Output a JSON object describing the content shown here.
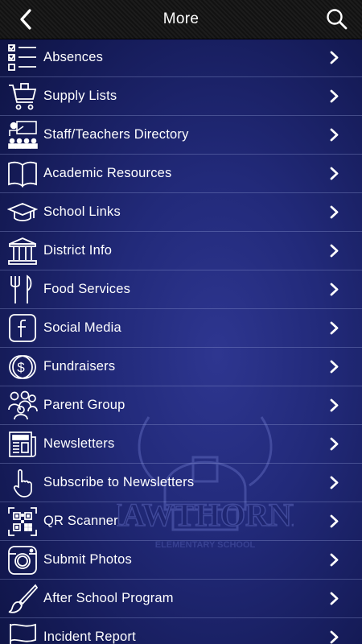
{
  "header": {
    "title": "More",
    "back_icon": "chevron-left-icon",
    "search_icon": "search-icon",
    "background": "#151515"
  },
  "colors": {
    "background_center": "#2e3690",
    "background_edge": "#0d1240",
    "row_divider": "#8a92c8",
    "text": "#ffffff"
  },
  "watermark": {
    "name": "HAWTHORNE",
    "subtitle": "ELEMENTARY SCHOOL"
  },
  "menu": {
    "items": [
      {
        "label": "Absences",
        "icon": "checklist-icon"
      },
      {
        "label": "Supply Lists",
        "icon": "shopping-cart-icon"
      },
      {
        "label": "Staff/Teachers Directory",
        "icon": "classroom-teacher-icon"
      },
      {
        "label": "Academic Resources",
        "icon": "open-book-icon"
      },
      {
        "label": "School Links",
        "icon": "graduation-cap-icon"
      },
      {
        "label": "District Info",
        "icon": "building-columns-icon"
      },
      {
        "label": "Food Services",
        "icon": "fork-knife-icon"
      },
      {
        "label": "Social Media",
        "icon": "facebook-icon"
      },
      {
        "label": "Fundraisers",
        "icon": "dollar-coin-icon"
      },
      {
        "label": "Parent Group",
        "icon": "people-group-icon"
      },
      {
        "label": "Newsletters",
        "icon": "newspaper-icon"
      },
      {
        "label": "Subscribe to Newsletters",
        "icon": "pointing-hand-icon"
      },
      {
        "label": "QR Scanner",
        "icon": "qr-code-icon"
      },
      {
        "label": "Submit Photos",
        "icon": "camera-icon"
      },
      {
        "label": "After School Program",
        "icon": "paintbrush-icon"
      },
      {
        "label": "Incident Report",
        "icon": "flag-icon"
      }
    ]
  }
}
